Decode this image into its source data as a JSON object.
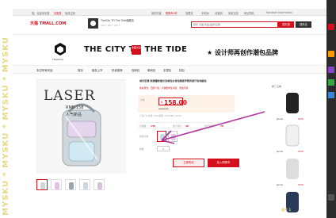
{
  "watermark": "MYSKU * MYSKU * MYSKU * MYSKU",
  "topbar": {
    "left": [
      "喵，欢迎来天猫",
      "请登录",
      "免费注册"
    ],
    "right": [
      "我的淘宝",
      "购物车0件",
      "收藏夹",
      "手机版",
      "淘宝网",
      "商家支持",
      "网站导航",
      "Handset information"
    ]
  },
  "header": {
    "logo": "天猫 TMALL.COM",
    "store_title": "TheCity TO The Tide旗舰店",
    "store_stats": "4.8 ↑ 4.8 ↑ 4.8 ↑",
    "search_placeholder": "搜索 天猫 商品/品牌/店铺",
    "search_all": "搜天猫",
    "search_store": "搜本店"
  },
  "banner": {
    "brand_sub": "Theomity",
    "title": "THE CITY TO THE TIDE",
    "follow": "收藏关注",
    "slogan": "★ 设计师再创作潮包品牌"
  },
  "nav": [
    "本店所有商品",
    "首页",
    "新品上市",
    "热卖推荐",
    "双肩包",
    "单肩包",
    "手提包",
    "钱包"
  ],
  "product": {
    "image_text": [
      "LASER",
      "RMB:158",
      "人气新品"
    ],
    "title": "城市至潮 新潮镭射激光双肩包女背包韩版学院风旅行包电脑包",
    "subtitle": "炫彩激光 · 百搭个性 · 大容量学生书包 · 男女同款",
    "price_label": "价格",
    "price": "158.00",
    "currency": "¥",
    "price_original": "¥ 297.00",
    "shipping": "广东广州  快递: 0.00  邮费: 0.00  EMS: 20.00",
    "stats_monthly": "月销量",
    "stats_monthly_value": "145",
    "stats_reviews": "累计评价",
    "stats_reviews_value": "36",
    "stats_points": "送天猫积分",
    "stats_points_value": "79",
    "color_label": "颜色分类",
    "qty_label": "数量",
    "qty_value": "1",
    "buy_label": "立即购买",
    "cart_label": "加入购物车"
  },
  "sidebar": {
    "head": "看了又看",
    "items": [
      {
        "label": "Jennie",
        "price": "¥158"
      },
      {
        "label": "Jennie",
        "price": "¥158"
      },
      {
        "label": "Jennie",
        "price": "¥158"
      },
      {
        "label": "Jennie",
        "price": "¥158"
      }
    ]
  },
  "colors": {
    "accent": "#d3101c",
    "annotation": "#b1359c",
    "watermark": "#e3d36a"
  },
  "corner_text": "图片 1"
}
